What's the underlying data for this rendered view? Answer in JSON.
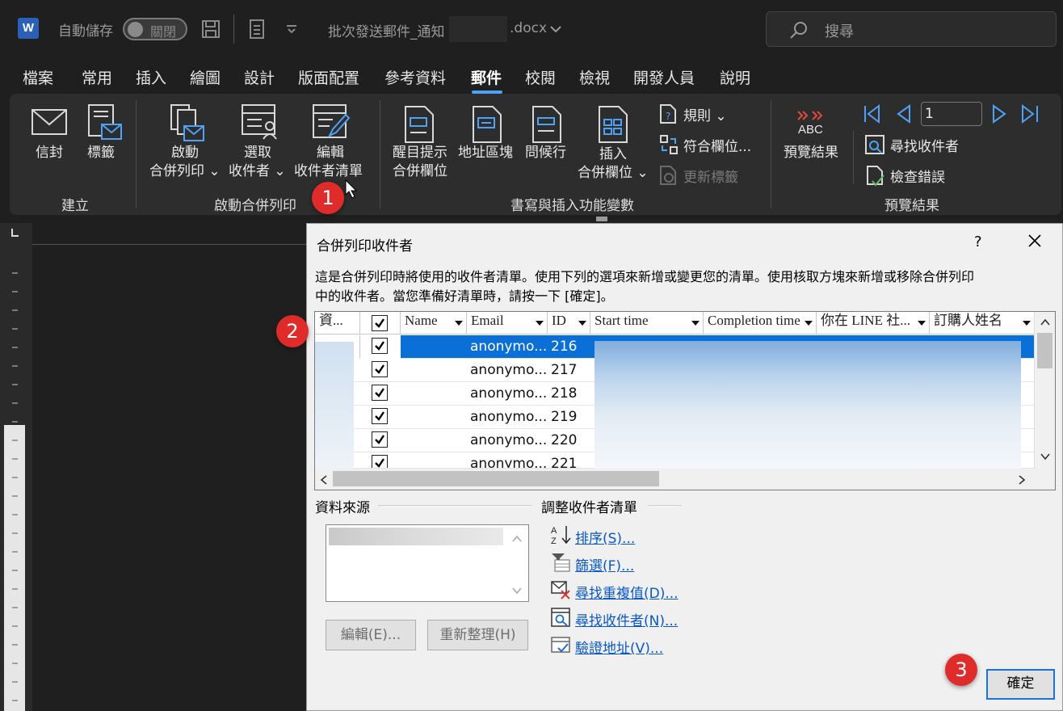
{
  "titlebar": {
    "autosave_label": "自動儲存",
    "autosave_state": "關閉",
    "doc_title": "批次發送郵件_通知",
    "doc_ext": ".docx",
    "search_placeholder": "搜尋"
  },
  "tabs": [
    "檔案",
    "常用",
    "插入",
    "繪圖",
    "設計",
    "版面配置",
    "參考資料",
    "郵件",
    "校閱",
    "檢視",
    "開發人員",
    "說明"
  ],
  "active_tab": "郵件",
  "ribbon": {
    "envelope": "信封",
    "labels": "標籤",
    "group_create": "建立",
    "start_merge_1": "啟動",
    "start_merge_2": "合併列印",
    "select_recipients_1": "選取",
    "select_recipients_2": "收件者",
    "edit_list_1": "編輯",
    "edit_list_2": "收件者清單",
    "group_start": "啟動合併列印",
    "highlight_1": "醒目提示",
    "highlight_2": "合併欄位",
    "address_block": "地址區塊",
    "greeting": "問候行",
    "insert_field_1": "插入",
    "insert_field_2": "合併欄位",
    "rules": "規則",
    "match_fields": "符合欄位...",
    "update_labels": "更新標籤",
    "group_write": "書寫與插入功能變數",
    "preview_results": "預覽結果",
    "record_number": "1",
    "find_recipient": "尋找收件者",
    "check_errors": "檢查錯誤",
    "group_preview": "預覽結果"
  },
  "dialog": {
    "title": "合併列印收件者",
    "help": "?",
    "description_1": "這是合併列印時將使用的收件者清單。使用下列的選項來新增或變更您的清單。使用核取方塊來新增或移除合併列印",
    "description_2": "中的收件者。當您準備好清單時，請按一下 [確定]。",
    "columns": [
      "資...",
      "",
      "Name",
      "Email",
      "ID",
      "Start time",
      "Completion time",
      "你在 LINE 社...",
      "訂購人姓名"
    ],
    "rows": [
      {
        "email": "anonymo...",
        "id": "216",
        "checked": true
      },
      {
        "email": "anonymo...",
        "id": "217",
        "checked": true
      },
      {
        "email": "anonymo...",
        "id": "218",
        "checked": true
      },
      {
        "email": "anonymo...",
        "id": "219",
        "checked": true
      },
      {
        "email": "anonymo...",
        "id": "220",
        "checked": true
      },
      {
        "email": "anonymo...",
        "id": "221",
        "checked": true
      }
    ],
    "data_source_title": "資料來源",
    "adjust_title": "調整收件者清單",
    "edit_button": "編輯(E)...",
    "refresh_button": "重新整理(H)",
    "links": {
      "sort": "排序(S)...",
      "filter": "篩選(F)...",
      "duplicates": "尋找重複值(D)...",
      "find": "尋找收件者(N)...",
      "validate": "驗證地址(V)..."
    },
    "ok": "確定"
  },
  "badges": [
    "1",
    "2",
    "3"
  ],
  "colors": {
    "accent": "#4ea1f3",
    "selection": "#0a6fd6",
    "badge": "#e02b2b",
    "link": "#0b58c8"
  }
}
